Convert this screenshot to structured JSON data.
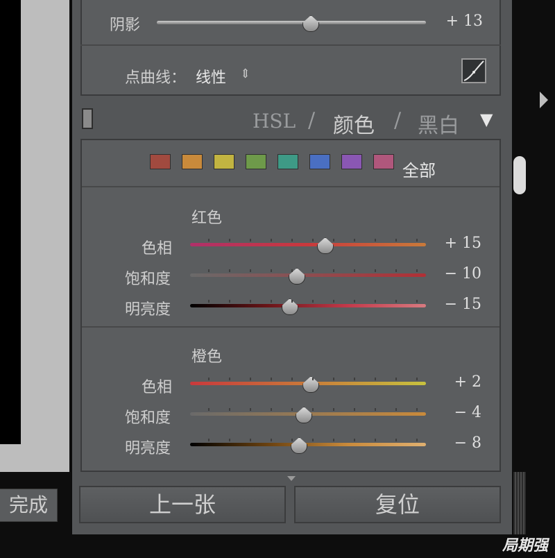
{
  "left": {
    "done_label": "完成"
  },
  "basic": {
    "shadows_label": "阴影",
    "shadows_value": "+ 13",
    "shadows_fraction": 0.57,
    "point_curve_label": "点曲线：",
    "point_curve_value": "线性",
    "point_curve_dropdown_glyph": "⇕"
  },
  "hsl_header": {
    "hsl": "HSL",
    "sep1": "/",
    "color": "颜色",
    "sep2": "/",
    "bw": "黑白",
    "collapse_glyph": "▼"
  },
  "swatches": {
    "colors": [
      "#a14a3f",
      "#c98a3b",
      "#c2b441",
      "#6e9a4a",
      "#3e9a86",
      "#4a6fc2",
      "#8a57b3",
      "#b0577c"
    ],
    "all_label": "全部"
  },
  "red": {
    "title": "红色",
    "hue_label": "色相",
    "hue_value": "+ 15",
    "hue_fraction": 0.57,
    "sat_label": "饱和度",
    "sat_value": "− 10",
    "sat_fraction": 0.45,
    "lum_label": "明亮度",
    "lum_value": "− 15",
    "lum_fraction": 0.42
  },
  "orange": {
    "title": "橙色",
    "hue_label": "色相",
    "hue_value": "+ 2",
    "hue_fraction": 0.51,
    "sat_label": "饱和度",
    "sat_value": "− 4",
    "sat_fraction": 0.48,
    "lum_label": "明亮度",
    "lum_value": "− 8",
    "lum_fraction": 0.46
  },
  "buttons": {
    "previous": "上一张",
    "reset": "复位"
  },
  "watermark": "局期强"
}
